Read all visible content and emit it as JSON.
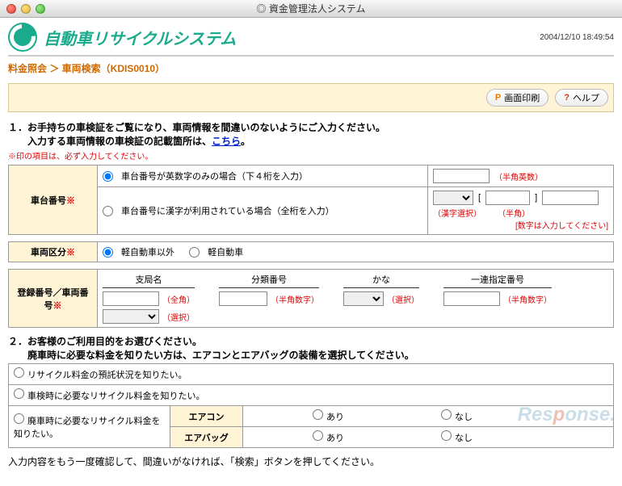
{
  "window": {
    "title": "資金管理法人システム"
  },
  "header": {
    "logo_text": "自動車リサイクルシステム",
    "timestamp": "2004/12/10 18:49:54"
  },
  "breadcrumb": "料金照会 ＞ 車両検索（KDIS0010）",
  "toolbar": {
    "print": "画面印刷",
    "print_badge": "P",
    "help": "ヘルプ",
    "help_badge": "?"
  },
  "section1": {
    "title": "１．お手持ちの車検証をご覧になり、車両情報を間違いのないようにご入力ください。",
    "sub": "　　入力する車両情報の車検証の記載箇所は、",
    "link": "こちら",
    "tail": "。",
    "req_note": "※印の項目は、必ず入力してください。"
  },
  "chassis": {
    "label": "車台番号",
    "opt1": "車台番号が英数字のみの場合（下４桁を入力）",
    "opt2": "車台番号に漢字が利用されている場合（全桁を入力）",
    "hint1": "（半角英数）",
    "hint2a": "（漢字選択）",
    "hint2b": "（半角）",
    "hint2c": "[数字は入力してください]"
  },
  "vclass": {
    "label": "車両区分",
    "opt1": "軽自動車以外",
    "opt2": "軽自動車"
  },
  "reg": {
    "label": "登録番号／車両番号",
    "col1": "支局名",
    "col2": "分類番号",
    "col3": "かな",
    "col4": "一連指定番号",
    "h_zenkaku": "（全角）",
    "h_sentaku": "（選択）",
    "h_hankaku": "（半角数字）"
  },
  "section2": {
    "title": "２．お客様のご利用目的をお選びください。",
    "sub": "　　廃車時に必要な料金を知りたい方は、エアコンとエアバッグの装備を選択してください。",
    "opt1": "リサイクル料金の預託状況を知りたい。",
    "opt2": "車検時に必要なリサイクル料金を知りたい。",
    "opt3": "廃車時に必要なリサイクル料金を知りたい。",
    "row1": "エアコン",
    "row2": "エアバッグ",
    "ari": "あり",
    "nashi": "なし"
  },
  "footer_note": "入力内容をもう一度確認して、間違いがなければ、「検索」ボタンを押してください。",
  "watermark": {
    "a": "Res",
    "b": "p",
    "c": "onse."
  }
}
